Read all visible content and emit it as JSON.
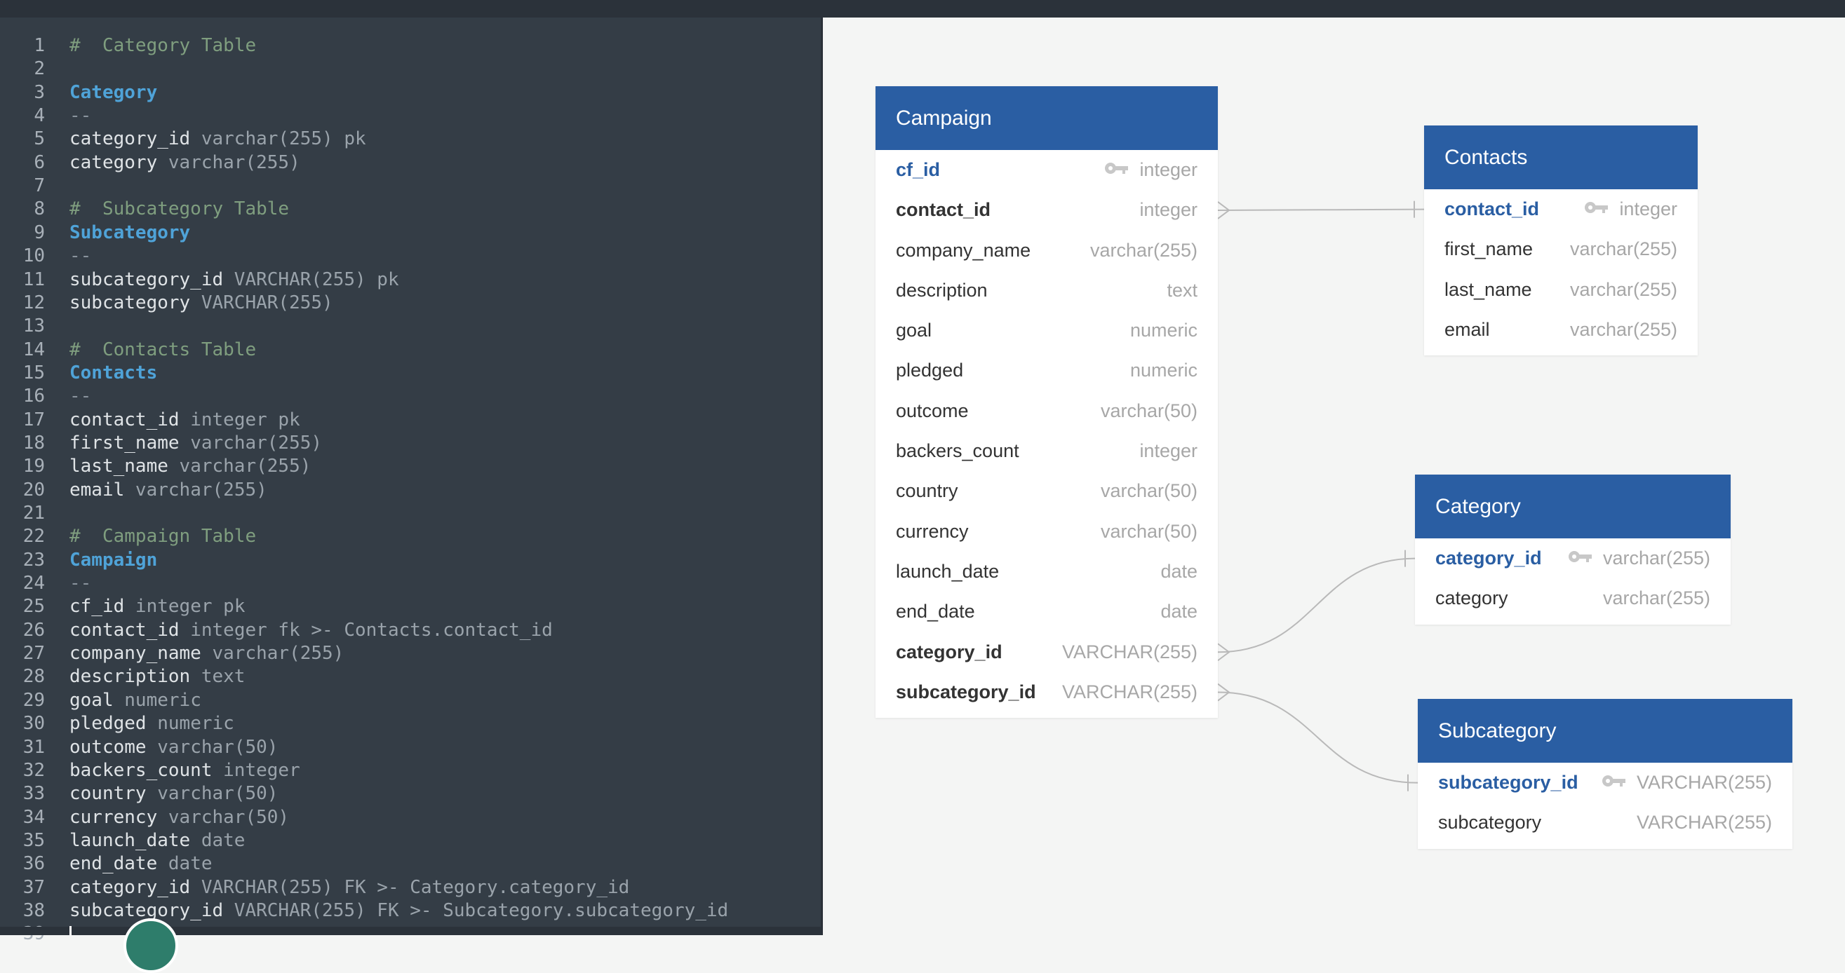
{
  "editor": {
    "lines": [
      {
        "n": "1",
        "parts": [
          {
            "t": "#  Category Table",
            "c": "comment"
          }
        ]
      },
      {
        "n": "2",
        "parts": []
      },
      {
        "n": "3",
        "parts": [
          {
            "t": "Category",
            "c": "table"
          }
        ]
      },
      {
        "n": "4",
        "parts": [
          {
            "t": "--",
            "c": "sep"
          }
        ]
      },
      {
        "n": "5",
        "parts": [
          {
            "t": "category_id",
            "c": "name"
          },
          {
            "t": " varchar(255) pk",
            "c": "type"
          }
        ]
      },
      {
        "n": "6",
        "parts": [
          {
            "t": "category",
            "c": "name"
          },
          {
            "t": " varchar(255)",
            "c": "type"
          }
        ]
      },
      {
        "n": "7",
        "parts": []
      },
      {
        "n": "8",
        "parts": [
          {
            "t": "#  Subcategory Table",
            "c": "comment"
          }
        ]
      },
      {
        "n": "9",
        "parts": [
          {
            "t": "Subcategory",
            "c": "table"
          }
        ]
      },
      {
        "n": "10",
        "parts": [
          {
            "t": "--",
            "c": "sep"
          }
        ]
      },
      {
        "n": "11",
        "parts": [
          {
            "t": "subcategory_id",
            "c": "name"
          },
          {
            "t": " VARCHAR(255) pk",
            "c": "type"
          }
        ]
      },
      {
        "n": "12",
        "parts": [
          {
            "t": "subcategory",
            "c": "name"
          },
          {
            "t": " VARCHAR(255)",
            "c": "type"
          }
        ]
      },
      {
        "n": "13",
        "parts": []
      },
      {
        "n": "14",
        "parts": [
          {
            "t": "#  Contacts Table",
            "c": "comment"
          }
        ]
      },
      {
        "n": "15",
        "parts": [
          {
            "t": "Contacts",
            "c": "table"
          }
        ]
      },
      {
        "n": "16",
        "parts": [
          {
            "t": "--",
            "c": "sep"
          }
        ]
      },
      {
        "n": "17",
        "parts": [
          {
            "t": "contact_id",
            "c": "name"
          },
          {
            "t": " integer pk",
            "c": "type"
          }
        ]
      },
      {
        "n": "18",
        "parts": [
          {
            "t": "first_name",
            "c": "name"
          },
          {
            "t": " varchar(255)",
            "c": "type"
          }
        ]
      },
      {
        "n": "19",
        "parts": [
          {
            "t": "last_name",
            "c": "name"
          },
          {
            "t": " varchar(255)",
            "c": "type"
          }
        ]
      },
      {
        "n": "20",
        "parts": [
          {
            "t": "email",
            "c": "name"
          },
          {
            "t": " varchar(255)",
            "c": "type"
          }
        ]
      },
      {
        "n": "21",
        "parts": []
      },
      {
        "n": "22",
        "parts": [
          {
            "t": "#  Campaign Table",
            "c": "comment"
          }
        ]
      },
      {
        "n": "23",
        "parts": [
          {
            "t": "Campaign",
            "c": "table"
          }
        ]
      },
      {
        "n": "24",
        "parts": [
          {
            "t": "--",
            "c": "sep"
          }
        ]
      },
      {
        "n": "25",
        "parts": [
          {
            "t": "cf_id",
            "c": "name"
          },
          {
            "t": " integer pk",
            "c": "type"
          }
        ]
      },
      {
        "n": "26",
        "parts": [
          {
            "t": "contact_id",
            "c": "name"
          },
          {
            "t": " integer fk >- Contacts.contact_id",
            "c": "type"
          }
        ]
      },
      {
        "n": "27",
        "parts": [
          {
            "t": "company_name",
            "c": "name"
          },
          {
            "t": " varchar(255)",
            "c": "type"
          }
        ]
      },
      {
        "n": "28",
        "parts": [
          {
            "t": "description",
            "c": "name"
          },
          {
            "t": " text",
            "c": "type"
          }
        ]
      },
      {
        "n": "29",
        "parts": [
          {
            "t": "goal",
            "c": "name"
          },
          {
            "t": " numeric",
            "c": "type"
          }
        ]
      },
      {
        "n": "30",
        "parts": [
          {
            "t": "pledged",
            "c": "name"
          },
          {
            "t": " numeric",
            "c": "type"
          }
        ]
      },
      {
        "n": "31",
        "parts": [
          {
            "t": "outcome",
            "c": "name"
          },
          {
            "t": " varchar(50)",
            "c": "type"
          }
        ]
      },
      {
        "n": "32",
        "parts": [
          {
            "t": "backers_count",
            "c": "name"
          },
          {
            "t": " integer",
            "c": "type"
          }
        ]
      },
      {
        "n": "33",
        "parts": [
          {
            "t": "country",
            "c": "name"
          },
          {
            "t": " varchar(50)",
            "c": "type"
          }
        ]
      },
      {
        "n": "34",
        "parts": [
          {
            "t": "currency",
            "c": "name"
          },
          {
            "t": " varchar(50)",
            "c": "type"
          }
        ]
      },
      {
        "n": "35",
        "parts": [
          {
            "t": "launch_date",
            "c": "name"
          },
          {
            "t": " date",
            "c": "type"
          }
        ]
      },
      {
        "n": "36",
        "parts": [
          {
            "t": "end_date",
            "c": "name"
          },
          {
            "t": " date",
            "c": "type"
          }
        ]
      },
      {
        "n": "37",
        "parts": [
          {
            "t": "category_id",
            "c": "name"
          },
          {
            "t": " VARCHAR(255) FK >- Category.category_id",
            "c": "type"
          }
        ]
      },
      {
        "n": "38",
        "parts": [
          {
            "t": "subcategory_id",
            "c": "name"
          },
          {
            "t": " VARCHAR(255) FK >- Subcategory.subcategory_id",
            "c": "type"
          }
        ]
      },
      {
        "n": "39",
        "parts": []
      }
    ]
  },
  "diagram": {
    "tables": [
      {
        "id": "campaign",
        "title": "Campaign",
        "fields": [
          {
            "name": "cf_id",
            "type": "integer",
            "pk": true
          },
          {
            "name": "contact_id",
            "type": "integer",
            "fk": true
          },
          {
            "name": "company_name",
            "type": "varchar(255)"
          },
          {
            "name": "description",
            "type": "text"
          },
          {
            "name": "goal",
            "type": "numeric"
          },
          {
            "name": "pledged",
            "type": "numeric"
          },
          {
            "name": "outcome",
            "type": "varchar(50)"
          },
          {
            "name": "backers_count",
            "type": "integer"
          },
          {
            "name": "country",
            "type": "varchar(50)"
          },
          {
            "name": "currency",
            "type": "varchar(50)"
          },
          {
            "name": "launch_date",
            "type": "date"
          },
          {
            "name": "end_date",
            "type": "date"
          },
          {
            "name": "category_id",
            "type": "VARCHAR(255)",
            "fk": true
          },
          {
            "name": "subcategory_id",
            "type": "VARCHAR(255)",
            "fk": true
          }
        ]
      },
      {
        "id": "contacts",
        "title": "Contacts",
        "fields": [
          {
            "name": "contact_id",
            "type": "integer",
            "pk": true
          },
          {
            "name": "first_name",
            "type": "varchar(255)"
          },
          {
            "name": "last_name",
            "type": "varchar(255)"
          },
          {
            "name": "email",
            "type": "varchar(255)"
          }
        ]
      },
      {
        "id": "category",
        "title": "Category",
        "fields": [
          {
            "name": "category_id",
            "type": "varchar(255)",
            "pk": true
          },
          {
            "name": "category",
            "type": "varchar(255)"
          }
        ]
      },
      {
        "id": "subcategory",
        "title": "Subcategory",
        "fields": [
          {
            "name": "subcategory_id",
            "type": "VARCHAR(255)",
            "pk": true
          },
          {
            "name": "subcategory",
            "type": "VARCHAR(255)"
          }
        ]
      }
    ],
    "colors": {
      "header": "#2a5ea3",
      "pk": "#2a5ea3",
      "connector": "#b9b9b9"
    }
  }
}
